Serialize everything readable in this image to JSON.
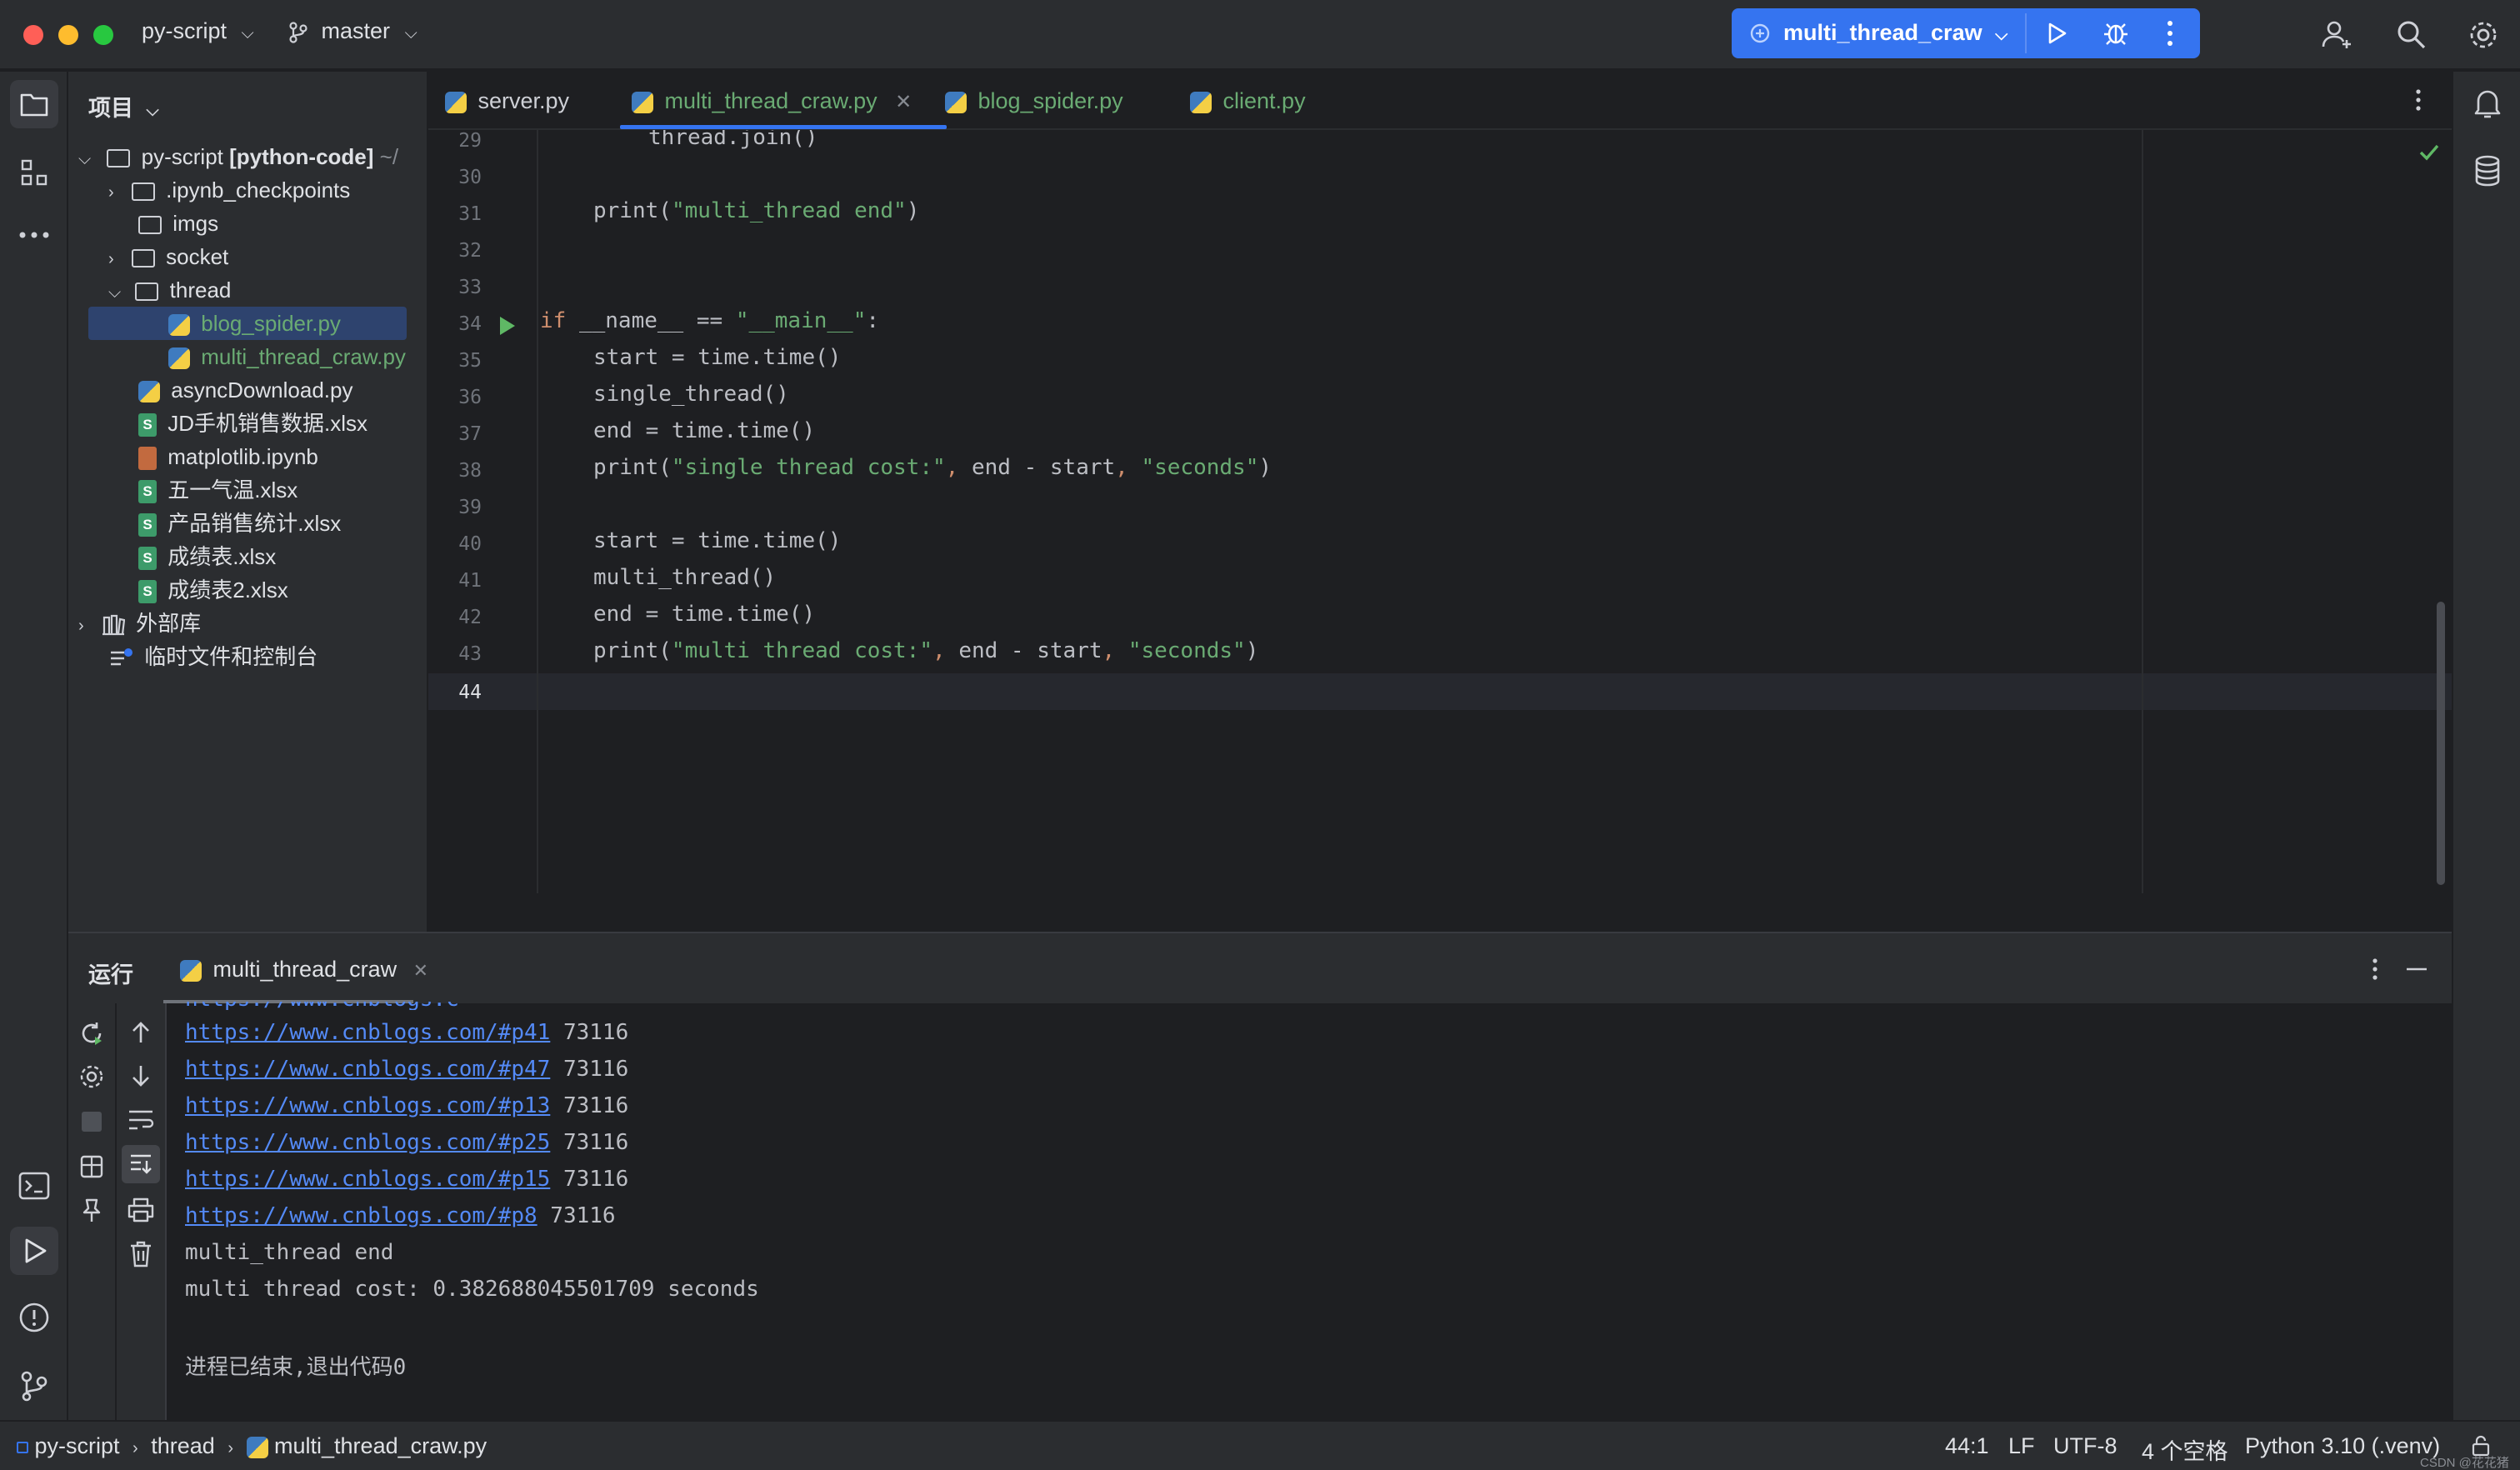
{
  "titlebar": {
    "project_name": "py-script",
    "branch": "master",
    "run_config": "multi_thread_craw"
  },
  "project_panel": {
    "title": "项目",
    "root": {
      "name": "py-script",
      "module": "[python-code]",
      "path_hint": "~/"
    },
    "items": [
      {
        "label": ".ipynb_checkpoints",
        "type": "folder"
      },
      {
        "label": "imgs",
        "type": "folder"
      },
      {
        "label": "socket",
        "type": "folder"
      },
      {
        "label": "thread",
        "type": "folder"
      },
      {
        "label": "blog_spider.py",
        "type": "python"
      },
      {
        "label": "multi_thread_craw.py",
        "type": "python"
      },
      {
        "label": "asyncDownload.py",
        "type": "python"
      },
      {
        "label": "JD手机销售数据.xlsx",
        "type": "excel"
      },
      {
        "label": "matplotlib.ipynb",
        "type": "notebook"
      },
      {
        "label": "五一气温.xlsx",
        "type": "excel"
      },
      {
        "label": "产品销售统计.xlsx",
        "type": "excel"
      },
      {
        "label": "成绩表.xlsx",
        "type": "excel"
      },
      {
        "label": "成绩表2.xlsx",
        "type": "excel"
      },
      {
        "label": "外部库",
        "type": "library"
      },
      {
        "label": "临时文件和控制台",
        "type": "scratch"
      }
    ]
  },
  "editor_tabs": [
    {
      "label": "server.py"
    },
    {
      "label": "multi_thread_craw.py",
      "active": true
    },
    {
      "label": "blog_spider.py"
    },
    {
      "label": "client.py"
    }
  ],
  "editor": {
    "line_numbers": [
      "29",
      "30",
      "31",
      "32",
      "33",
      "34",
      "35",
      "36",
      "37",
      "38",
      "39",
      "40",
      "41",
      "42",
      "43",
      "44"
    ],
    "lines": {
      "l29": "thread.join()",
      "l31_fn": "print",
      "l31_str": "\"multi_thread end\"",
      "l34_kw": "if",
      "l34_rest": "__name__ == ",
      "l34_str": "\"__main__\"",
      "l35": "start = time.time()",
      "l36": "single_thread()",
      "l37": "end = time.time()",
      "l38_str1": "\"single thread cost:\"",
      "l38_mid": "end - start",
      "l38_str2": "\"seconds\"",
      "l40": "start = time.time()",
      "l41": "multi_thread()",
      "l42": "end = time.time()",
      "l43_str1": "\"multi thread cost:\"",
      "l43_mid": "end - start",
      "l43_str2": "\"seconds\""
    }
  },
  "run_panel": {
    "title": "运行",
    "tab": "multi_thread_craw",
    "output": [
      {
        "url": "https://www.cnblogs.com/#p41",
        "value": "73116"
      },
      {
        "url": "https://www.cnblogs.com/#p47",
        "value": "73116"
      },
      {
        "url": "https://www.cnblogs.com/#p13",
        "value": "73116"
      },
      {
        "url": "https://www.cnblogs.com/#p25",
        "value": "73116"
      },
      {
        "url": "https://www.cnblogs.com/#p15",
        "value": "73116"
      },
      {
        "url": "https://www.cnblogs.com/#p8",
        "value": "73116"
      }
    ],
    "end_line": "multi_thread end",
    "cost_line": "multi thread cost: 0.382688045501709 seconds",
    "exit_line": "进程已结束,退出代码0"
  },
  "statusbar": {
    "breadcrumb": [
      "py-script",
      "thread",
      "multi_thread_craw.py"
    ],
    "position": "44:1",
    "line_sep": "LF",
    "encoding": "UTF-8",
    "indent": "4 个空格",
    "interpreter": "Python 3.10 (.venv)",
    "watermark": "CSDN @花花猪"
  },
  "colors": {
    "accent": "#3574f0",
    "keyword": "#cf8e6d",
    "string": "#6aab73",
    "link": "#548af7",
    "run_green": "#5fb865"
  }
}
